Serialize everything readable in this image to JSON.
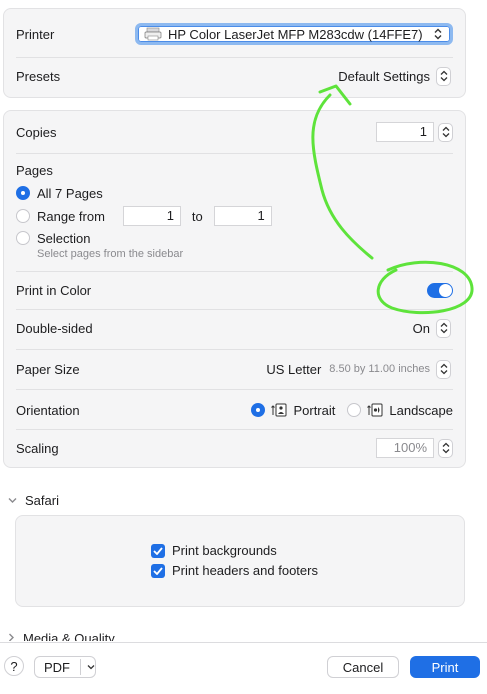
{
  "printer": {
    "label": "Printer",
    "value": "HP Color LaserJet MFP M283cdw (14FFE7)"
  },
  "presets": {
    "label": "Presets",
    "value": "Default Settings"
  },
  "copies": {
    "label": "Copies",
    "value": "1"
  },
  "pages": {
    "label": "Pages",
    "all_label": "All 7 Pages",
    "range_label": "Range from",
    "range_from": "1",
    "range_to_label": "to",
    "range_to": "1",
    "selection_label": "Selection",
    "selection_hint": "Select pages from the sidebar"
  },
  "print_in_color": {
    "label": "Print in Color",
    "enabled": true
  },
  "double_sided": {
    "label": "Double-sided",
    "value": "On"
  },
  "paper_size": {
    "label": "Paper Size",
    "value": "US Letter",
    "dimensions": "8.50 by 11.00 inches"
  },
  "orientation": {
    "label": "Orientation",
    "portrait_label": "Portrait",
    "landscape_label": "Landscape",
    "selected": "Portrait"
  },
  "scaling": {
    "label": "Scaling",
    "value": "100%"
  },
  "safari_section": {
    "title": "Safari",
    "print_backgrounds": "Print backgrounds",
    "print_headers_footers": "Print headers and footers"
  },
  "media_quality": {
    "title": "Media & Quality"
  },
  "footer": {
    "help_label": "?",
    "pdf_label": "PDF",
    "cancel_label": "Cancel",
    "print_label": "Print"
  },
  "colors": {
    "accent": "#1f6fe5",
    "annotation": "#5ee33b"
  }
}
